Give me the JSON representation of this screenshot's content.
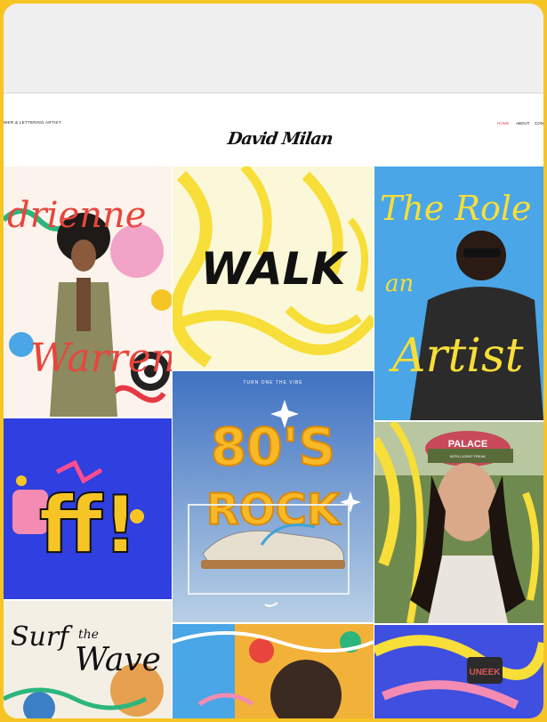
{
  "header": {
    "tagline": "WER & LETTERING ARTIST",
    "logo": "David Milan",
    "nav": [
      "HOME",
      "ABOUT",
      "CON"
    ]
  },
  "tiles": {
    "adrienne": {
      "words": [
        "drienne",
        "Warren"
      ]
    },
    "walk": {
      "word": "WALK"
    },
    "artist": {
      "words": [
        "The Role of",
        "an",
        "Artist"
      ]
    },
    "off": {
      "word": "ff!"
    },
    "sneaker": {
      "kicker": "TURN ONE THE VIBE",
      "line1": "80'S",
      "line2": "ROCK"
    },
    "palace": {
      "cap_text": "PALACE",
      "cap_sub": "INTELLIGENT FREAK"
    },
    "surf": {
      "words": [
        "Surf",
        "the",
        "Wave"
      ]
    },
    "uneek": {
      "word": "UNEEK"
    }
  },
  "colors": {
    "accent_frame": "#f6c525",
    "nav_active": "#e05050",
    "tile_blue": "#2f3fe0",
    "tile_sky": "#4aa6e6",
    "tile_yellow": "#f7de38"
  }
}
